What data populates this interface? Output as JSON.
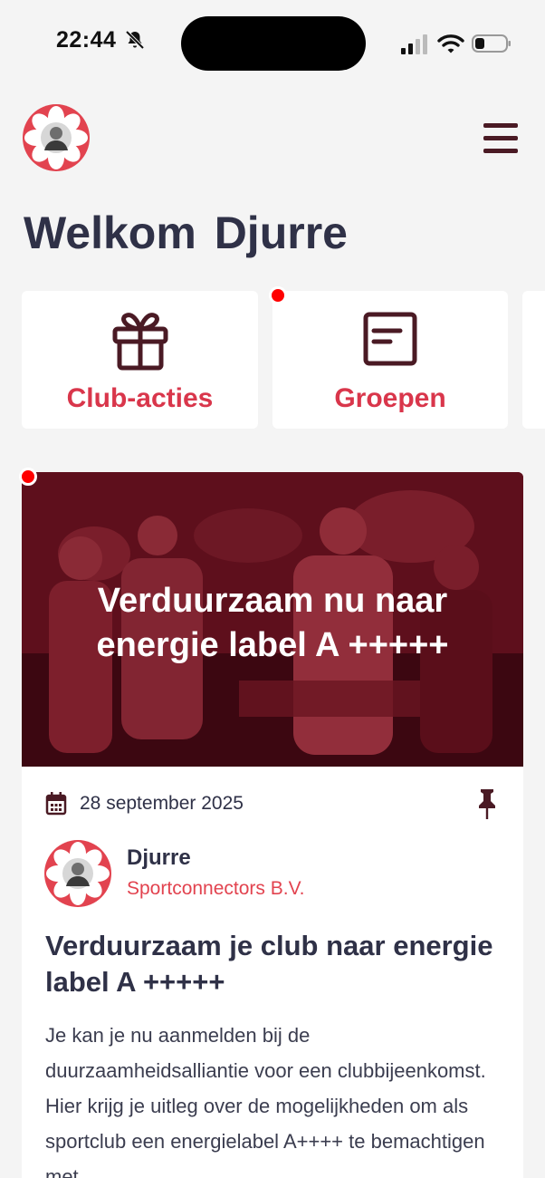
{
  "status_bar": {
    "time": "22:44"
  },
  "header": {
    "welcome_prefix": "Welkom",
    "user_name": "Djurre"
  },
  "tiles": [
    {
      "label": "Club-acties",
      "icon": "gift-icon"
    },
    {
      "label": "Groepen",
      "icon": "newspaper-icon"
    }
  ],
  "post": {
    "banner_title": "Verduurzaam nu naar energie label A +++++",
    "date": "28 september 2025",
    "author": "Djurre",
    "company": "Sportconnectors B.V.",
    "title": "Verduurzaam je club naar energie label A +++++",
    "body": "Je kan je nu aanmelden bij de duurzaamheidsalliantie voor een clubbijeenkomst. Hier krijg je uitleg over de mogelijkheden om als sportclub een energielabel A++++ te bemachtigen met"
  },
  "colors": {
    "accent": "#d9364b",
    "dark": "#2f3147",
    "icon": "#4a1a24",
    "notification": "#ff0000"
  }
}
